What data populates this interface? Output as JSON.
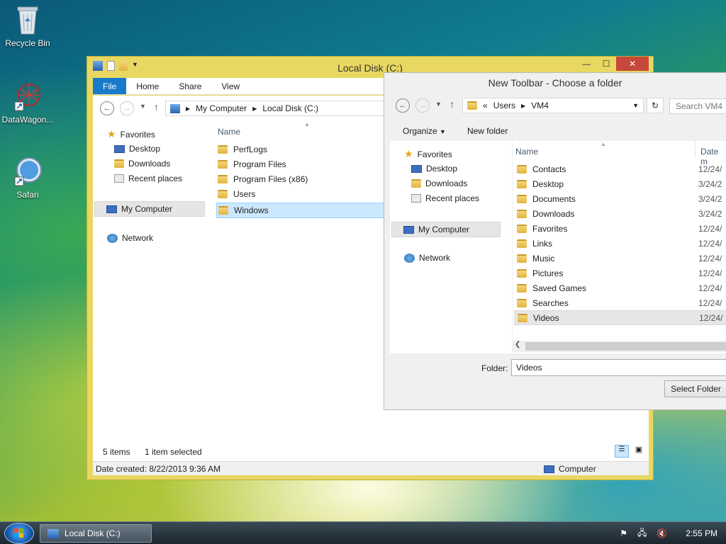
{
  "desktop": {
    "icons": [
      {
        "label": "Recycle Bin"
      },
      {
        "label": "DataWagon..."
      },
      {
        "label": "Safari"
      }
    ]
  },
  "explorer": {
    "title": "Local Disk (C:)",
    "tabs": [
      "File",
      "Home",
      "Share",
      "View"
    ],
    "breadcrumb": [
      "My Computer",
      "Local Disk (C:)"
    ],
    "nav": {
      "favorites": "Favorites",
      "favorites_items": [
        "Desktop",
        "Downloads",
        "Recent places"
      ],
      "computer": "My Computer",
      "network": "Network"
    },
    "column_name": "Name",
    "files": [
      "PerfLogs",
      "Program Files",
      "Program Files (x86)",
      "Users",
      "Windows"
    ],
    "selected_file": "Windows",
    "status_items": "5 items",
    "status_selected": "1 item selected",
    "details_bar": "Date created: 8/22/2013 9:36 AM",
    "details_right": "Computer"
  },
  "dialog": {
    "title": "New Toolbar - Choose a folder",
    "path": [
      "Users",
      "VM4"
    ],
    "path_prefix": "«",
    "search_placeholder": "Search VM4",
    "organize_label": "Organize",
    "new_folder_label": "New folder",
    "nav": {
      "favorites": "Favorites",
      "favorites_items": [
        "Desktop",
        "Downloads",
        "Recent places"
      ],
      "computer": "My Computer",
      "network": "Network"
    },
    "columns": {
      "name": "Name",
      "date": "Date m"
    },
    "items": [
      {
        "name": "Contacts",
        "date": "12/24/"
      },
      {
        "name": "Desktop",
        "date": "3/24/2"
      },
      {
        "name": "Documents",
        "date": "3/24/2"
      },
      {
        "name": "Downloads",
        "date": "3/24/2"
      },
      {
        "name": "Favorites",
        "date": "12/24/"
      },
      {
        "name": "Links",
        "date": "12/24/"
      },
      {
        "name": "Music",
        "date": "12/24/"
      },
      {
        "name": "Pictures",
        "date": "12/24/"
      },
      {
        "name": "Saved Games",
        "date": "12/24/"
      },
      {
        "name": "Searches",
        "date": "12/24/"
      },
      {
        "name": "Videos",
        "date": "12/24/"
      }
    ],
    "folder_label": "Folder:",
    "folder_value": "Videos",
    "select_button": "Select Folder"
  },
  "taskbar": {
    "task": "Local Disk (C:)",
    "clock": "2:55 PM"
  },
  "colors": {
    "ribbon_file": "#1979ca",
    "close": "#c7473a",
    "explorer_frame": "#e8d760"
  }
}
